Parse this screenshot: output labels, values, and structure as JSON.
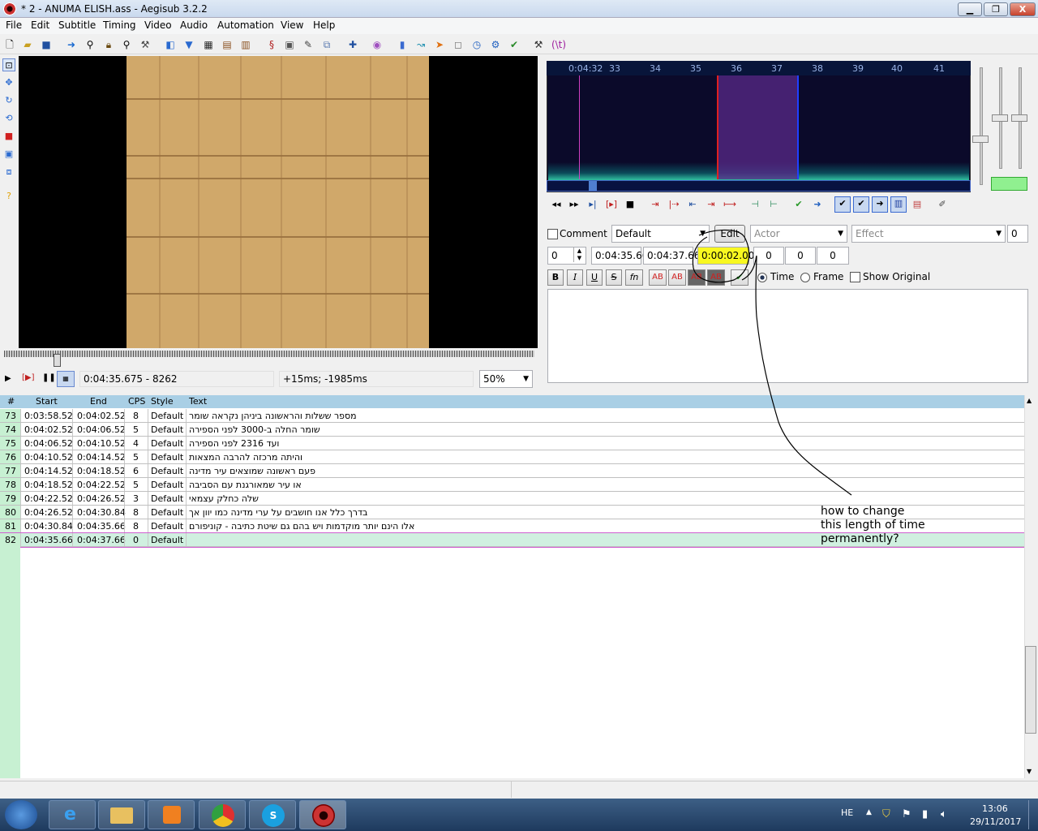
{
  "window": {
    "title": "* 2 - ANUMA ELISH.ass - Aegisub 3.2.2",
    "min": "▁",
    "max": "❐",
    "close": "X"
  },
  "menu": [
    "File",
    "Edit",
    "Subtitle",
    "Timing",
    "Video",
    "Audio",
    "Automation",
    "View",
    "Help"
  ],
  "toolbar_icons": [
    "new-file-icon",
    "open-file-icon",
    "save-icon",
    "jump-icon",
    "zoom-in-icon",
    "lock-icon",
    "zoom-out-icon",
    "wand-icon",
    "color-picker-icon",
    "film-icon",
    "grid-icon",
    "lines-icon",
    "sort-icon",
    "properties-icon",
    "styles-icon",
    "attachments-icon",
    "fonts-icon",
    "translation-icon",
    "spell-icon",
    "anime-icon",
    "shift-icon",
    "timing-icon",
    "kanji-icon",
    "resample-icon",
    "select-icon",
    "clock-icon",
    "check-icon",
    "tools-icon",
    "regex-icon"
  ],
  "video": {
    "time": "0:04:35.675 - 8262",
    "offset": "+15ms; -1985ms",
    "zoom": "50%"
  },
  "audio": {
    "ticks": [
      "0:04:32",
      "33",
      "34",
      "35",
      "36",
      "37",
      "38",
      "39",
      "40",
      "41"
    ]
  },
  "edit": {
    "comment_label": "Comment",
    "style": "Default",
    "edit_button": "Edit",
    "actor": "Actor",
    "effect": "Effect",
    "layer": "0",
    "margin_counter": "0",
    "start": "0:04:35.66",
    "end": "0:04:37.66",
    "duration": "0:00:02.00",
    "margin_l": "0",
    "margin_r": "0",
    "margin_v": "0",
    "time_label": "Time",
    "frame_label": "Frame",
    "show_original": "Show Original",
    "fmt": [
      "B",
      "I",
      "U",
      "S",
      "fn",
      "AB",
      "AB",
      "AB",
      "AB"
    ]
  },
  "grid": {
    "headers": [
      "#",
      "Start",
      "End",
      "CPS",
      "Style",
      "Text"
    ],
    "rows": [
      {
        "n": "73",
        "start": "0:03:58.52",
        "end": "0:04:02.52",
        "cps": "8",
        "style": "Default",
        "text": "מספר ששלות והראשונה ביניהן נקראה שומר"
      },
      {
        "n": "74",
        "start": "0:04:02.52",
        "end": "0:04:06.52",
        "cps": "5",
        "style": "Default",
        "text": "שומר החלה ב-3000 לפני הספירה"
      },
      {
        "n": "75",
        "start": "0:04:06.52",
        "end": "0:04:10.52",
        "cps": "4",
        "style": "Default",
        "text": "ועד 2316 לפני הספירה"
      },
      {
        "n": "76",
        "start": "0:04:10.52",
        "end": "0:04:14.52",
        "cps": "5",
        "style": "Default",
        "text": "והיתה מרכזה להרבה המצאות"
      },
      {
        "n": "77",
        "start": "0:04:14.52",
        "end": "0:04:18.52",
        "cps": "6",
        "style": "Default",
        "text": "פעם ראשונה שמוצאים עיר מדינה"
      },
      {
        "n": "78",
        "start": "0:04:18.52",
        "end": "0:04:22.52",
        "cps": "5",
        "style": "Default",
        "text": "או עיר שמאורגנת עם הסביבה"
      },
      {
        "n": "79",
        "start": "0:04:22.52",
        "end": "0:04:26.52",
        "cps": "3",
        "style": "Default",
        "text": "שלה כחלק עצמאי"
      },
      {
        "n": "80",
        "start": "0:04:26.52",
        "end": "0:04:30.84",
        "cps": "8",
        "style": "Default",
        "text": "בדרך כלל אנו חושבים על ערי מדינה כמו יוון אך"
      },
      {
        "n": "81",
        "start": "0:04:30.84",
        "end": "0:04:35.66",
        "cps": "8",
        "style": "Default",
        "text": "אלו הינם יותר מוקדמות ויש בהם גם שיטת כתיבה - קוניפורם"
      },
      {
        "n": "82",
        "start": "0:04:35.66",
        "end": "0:04:37.66",
        "cps": "0",
        "style": "Default",
        "text": ""
      }
    ]
  },
  "annotation": [
    "how to change",
    "this length of time",
    "permanently?"
  ],
  "tray": {
    "lang": "HE",
    "time": "13:06",
    "date": "29/11/2017"
  },
  "taskbar_icons": [
    "windows-start-icon",
    "internet-explorer-icon",
    "file-explorer-icon",
    "media-player-icon",
    "chrome-icon",
    "skype-icon",
    "aegisub-icon"
  ]
}
